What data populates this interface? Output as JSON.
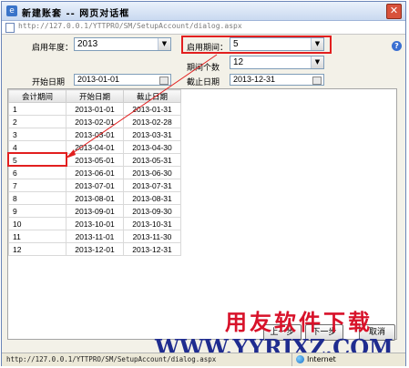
{
  "window": {
    "title": "新建账套 -- 网页对话框",
    "close_glyph": "✕"
  },
  "address": {
    "url": "http://127.0.0.1/YTTPRO/SM/SetupAccount/dialog.aspx"
  },
  "form": {
    "start_year_label": "启用年度：",
    "start_year_value": "2013",
    "start_period_label": "启用期间：",
    "start_period_value": "5",
    "period_count_label": "期间个数",
    "period_count_value": "12",
    "start_date_label": "开始日期",
    "start_date_value": "2013-01-01",
    "end_date_label": "截止日期",
    "end_date_value": "2013-12-31"
  },
  "grid": {
    "columns": [
      "会计期间",
      "开始日期",
      "截止日期"
    ],
    "rows": [
      [
        "1",
        "2013-01-01",
        "2013-01-31"
      ],
      [
        "2",
        "2013-02-01",
        "2013-02-28"
      ],
      [
        "3",
        "2013-03-01",
        "2013-03-31"
      ],
      [
        "4",
        "2013-04-01",
        "2013-04-30"
      ],
      [
        "5",
        "2013-05-01",
        "2013-05-31"
      ],
      [
        "6",
        "2013-06-01",
        "2013-06-30"
      ],
      [
        "7",
        "2013-07-01",
        "2013-07-31"
      ],
      [
        "8",
        "2013-08-01",
        "2013-08-31"
      ],
      [
        "9",
        "2013-09-01",
        "2013-09-30"
      ],
      [
        "10",
        "2013-10-01",
        "2013-10-31"
      ],
      [
        "11",
        "2013-11-01",
        "2013-11-30"
      ],
      [
        "12",
        "2013-12-01",
        "2013-12-31"
      ]
    ]
  },
  "buttons": {
    "prev": "上一步",
    "next": "下一步",
    "cancel": "取消"
  },
  "status": {
    "url": "http://127.0.0.1/YTTPRO/SM/SetupAccount/dialog.aspx",
    "zone": "Internet"
  },
  "watermark": {
    "line1": "用友软件下载",
    "line2": "WWW.YYRJXZ.COM"
  },
  "colors": {
    "highlight": "#e21f1f",
    "watermark_red": "#d8122a",
    "watermark_blue": "#1f2c8f"
  }
}
